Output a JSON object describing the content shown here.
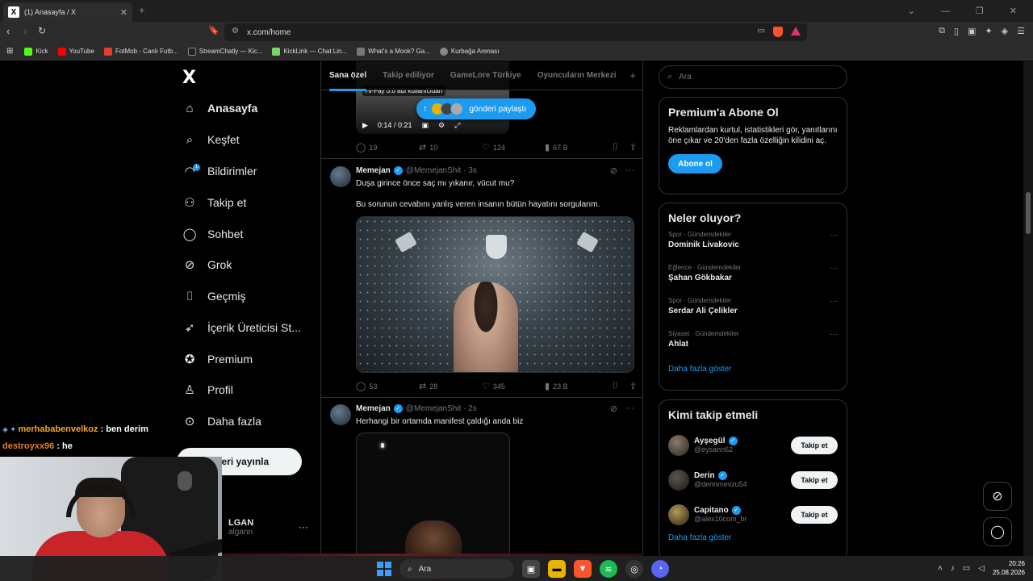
{
  "browser": {
    "tab_title": "(1) Anasayfa / X",
    "tab_close": "✕",
    "new_tab": "+",
    "url": "x.com/home",
    "bookmarks": [
      "Kick",
      "YouTube",
      "FotMob - Canlı Futb...",
      "StreamChatly — Kic...",
      "KickLink — Chat Lin...",
      "What's a Mook? Ga...",
      "Kurbağa Arenası"
    ],
    "bookmark_colors": [
      "#53fc18",
      "#ff0000",
      "#e33d2e",
      "#222222",
      "#7bd36a",
      "#777777",
      "#888888"
    ]
  },
  "sidebar": {
    "logo": "X",
    "items": [
      {
        "label": "Anasayfa",
        "icon": "home-icon",
        "glyph": "⌂"
      },
      {
        "label": "Keşfet",
        "icon": "search-icon",
        "glyph": "⌕"
      },
      {
        "label": "Bildirimler",
        "icon": "bell-icon",
        "glyph": "🔔",
        "badge": "1"
      },
      {
        "label": "Takip et",
        "icon": "follow-icon",
        "glyph": "👤"
      },
      {
        "label": "Sohbet",
        "icon": "chat-icon",
        "glyph": "💬"
      },
      {
        "label": "Grok",
        "icon": "grok-icon",
        "glyph": "⊘"
      },
      {
        "label": "Geçmiş",
        "icon": "bookmark-icon",
        "glyph": "🔖"
      },
      {
        "label": "İçerik Üreticisi St...",
        "icon": "rocket-icon",
        "glyph": "🚀"
      },
      {
        "label": "Premium",
        "icon": "premium-icon",
        "glyph": "✪"
      },
      {
        "label": "Profil",
        "icon": "profile-icon",
        "glyph": "👤"
      },
      {
        "label": "Daha fazla",
        "icon": "more-icon",
        "glyph": "⋯"
      }
    ],
    "post_button": "nderi yayınla",
    "account_name": "LGAN",
    "account_handle": "algann",
    "account_more": "···"
  },
  "feed": {
    "tabs": [
      "Sana özel",
      "Takip ediliyor",
      "GameLore Türkiye",
      "Oyuncuların Merkezi"
    ],
    "tab_add": "+",
    "share_pill": "gönderi paylaştı",
    "video_label": "Hi-Fay 3.0 adı kullanıcıdan",
    "video_time": "0:14 / 0:21",
    "post0_stats": {
      "replies": "19",
      "reposts": "10",
      "likes": "124",
      "views": "67 B"
    },
    "post1": {
      "name": "Memejan",
      "handle": "@MemejanShit · 3s",
      "line1": "Duşa girince önce saç mı yıkanır, vücut mu?",
      "line2": "Bu sorunun cevabını yanlış veren insanın bütün hayatını sorgularım.",
      "stats": {
        "replies": "53",
        "reposts": "28",
        "likes": "345",
        "views": "23 B"
      }
    },
    "post2": {
      "name": "Memejan",
      "handle": "@MemejanShit · 2s",
      "line1": "Herhangi bir ortamda manifest çaldığı anda biz"
    }
  },
  "right": {
    "search_placeholder": "Ara",
    "premium": {
      "title": "Premium'a Abone Ol",
      "desc": "Reklamlardan kurtul, istatistikleri gör, yanıtlarını öne çıkar ve 20'den fazla özelliğin kilidini aç.",
      "button": "Abone ol"
    },
    "trends_title": "Neler oluyor?",
    "trends": [
      {
        "cat": "Spor · Gündemdekiler",
        "title": "Dominik Livakovic"
      },
      {
        "cat": "Eğlence · Gündemdekiler",
        "title": "Şahan Gökbakar"
      },
      {
        "cat": "Spor · Gündemdekiler",
        "title": "Serdar Ali Çelikler"
      },
      {
        "cat": "Siyaset · Gündemdekiler",
        "title": "Ahlat"
      }
    ],
    "trends_more": "Daha fazla göster",
    "follow_title": "Kimi takip etmeli",
    "follow": [
      {
        "name": "Ayşegül",
        "handle": "@eysann62",
        "button": "Takip et"
      },
      {
        "name": "Derin",
        "handle": "@derinmevzu54",
        "button": "Takip et"
      },
      {
        "name": "Capitano",
        "handle": "@alex10com_br",
        "button": "Takip et"
      }
    ],
    "follow_more": "Daha fazla göster"
  },
  "stream_chat": [
    {
      "user": "merhababenvelkoz",
      "message": " : ben derim"
    },
    {
      "user": "destroyxx96",
      "message": " : he"
    }
  ],
  "taskbar": {
    "search": "Ara",
    "time": "20:26",
    "date": "25.08.2026"
  }
}
